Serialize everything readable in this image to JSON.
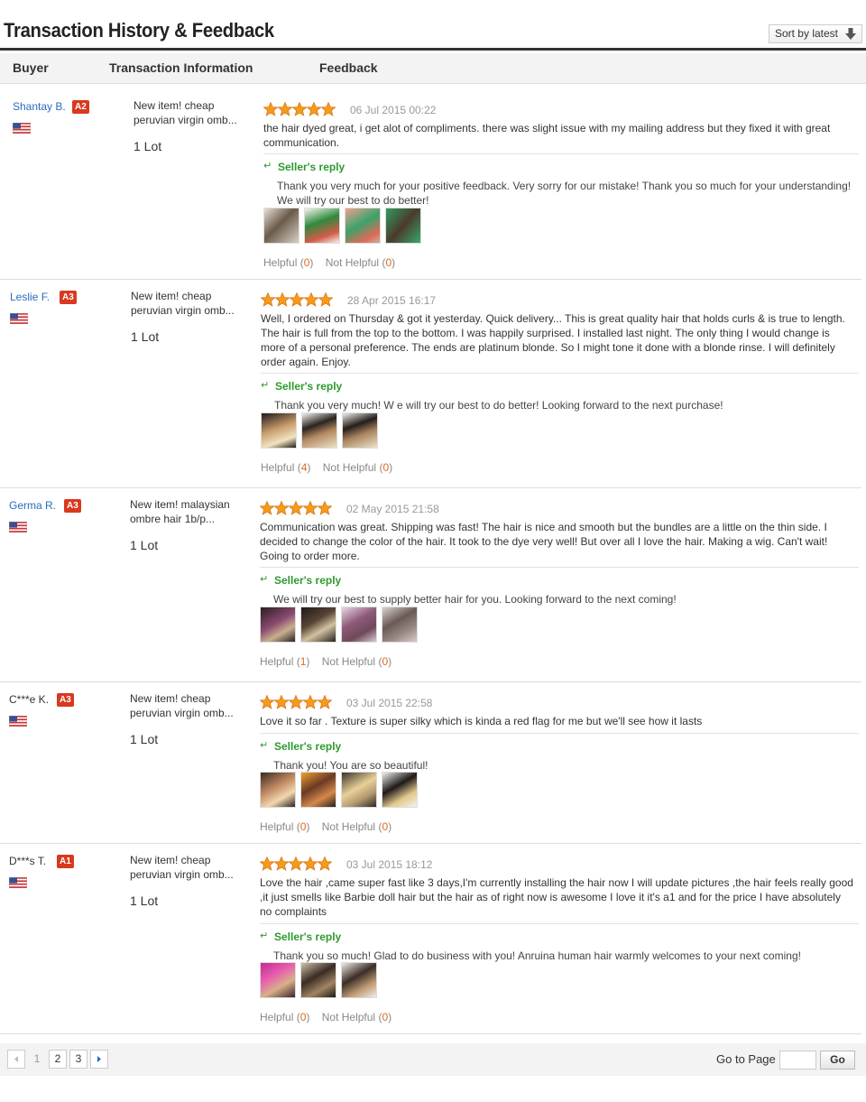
{
  "header": {
    "title": "Transaction History & Feedback",
    "sort_label": "Sort by latest"
  },
  "columns": {
    "buyer": "Buyer",
    "transaction": "Transaction Information",
    "feedback": "Feedback"
  },
  "reviews": [
    {
      "buyer": "Shantay B.",
      "level": "A2",
      "product_line1": "New item! cheap",
      "product_line2": "peruvian virgin omb...",
      "qty": "1 Lot",
      "stars": 5,
      "date": "06 Jul 2015 00:22",
      "comment": "the hair dyed great, i get alot of compliments. there was slight issue with my mailing address but they fixed it with great communication.",
      "reply_label": "Seller's reply",
      "reply": "Thank you very much for your positive feedback. Very sorry for our mistake! Thank you so much for your understanding! We will try our best to do better!",
      "photos": 4,
      "helpful_label": "Helpful",
      "helpful_count": "0",
      "not_helpful_label": "Not Helpful",
      "not_helpful_count": "0"
    },
    {
      "buyer": "Leslie F.",
      "level": "A3",
      "product_line1": "New item! cheap",
      "product_line2": "peruvian virgin omb...",
      "qty": "1 Lot",
      "stars": 5,
      "date": "28 Apr 2015 16:17",
      "comment": "Well, I ordered on Thursday & got it yesterday. Quick delivery... This is great quality hair that holds curls & is true to length. The hair is full from the top to the bottom. I was happily surprised. I installed last night. The only thing I would change is more of a personal preference. The ends are platinum blonde. So I might tone it done with a blonde rinse. I will definitely order again. Enjoy.",
      "reply_label": "Seller's reply",
      "reply": "Thank you very much! W e will try our best to do better! Looking forward to the next purchase!",
      "photos": 3,
      "helpful_label": "Helpful",
      "helpful_count": "4",
      "not_helpful_label": "Not Helpful",
      "not_helpful_count": "0"
    },
    {
      "buyer": "Germa R.",
      "level": "A3",
      "product_line1": "New item! malaysian",
      "product_line2": "ombre hair 1b/p...",
      "qty": "1 Lot",
      "stars": 5,
      "date": "02 May 2015 21:58",
      "comment": "Communication was great. Shipping was fast! The hair is nice and smooth but the bundles are a little on the thin side. I decided to change the color of the hair. It took to the dye very well! But over all I love the hair. Making a wig. Can't wait! Going to order more.",
      "reply_label": "Seller's reply",
      "reply": "We will try our best to supply better hair for you. Looking forward to the next coming!",
      "photos": 4,
      "helpful_label": "Helpful",
      "helpful_count": "1",
      "not_helpful_label": "Not Helpful",
      "not_helpful_count": "0"
    },
    {
      "buyer": "C***e K.",
      "level": "A3",
      "product_line1": "New item! cheap",
      "product_line2": "peruvian virgin omb...",
      "qty": "1 Lot",
      "stars": 5,
      "date": "03 Jul 2015 22:58",
      "comment": "Love it so far . Texture is super silky which is kinda a red flag for me but we'll see how it lasts",
      "reply_label": "Seller's reply",
      "reply": "Thank you! You are so beautiful!",
      "photos": 4,
      "helpful_label": "Helpful",
      "helpful_count": "0",
      "not_helpful_label": "Not Helpful",
      "not_helpful_count": "0"
    },
    {
      "buyer": "D***s T.",
      "level": "A1",
      "product_line1": "New item! cheap",
      "product_line2": "peruvian virgin omb...",
      "qty": "1 Lot",
      "stars": 5,
      "date": "03 Jul 2015 18:12",
      "comment": "Love the hair ,came super fast like 3 days,I'm currently installing the hair now I will update pictures ,the hair feels really good ,it just smells like Barbie doll hair but the hair as of right now is awesome I love it it's a1 and for the price I have absolutely no complaints",
      "reply_label": "Seller's reply",
      "reply": "Thank you so much! Glad to do business with you! Anruina human hair warmly welcomes to your next coming!",
      "photos": 3,
      "helpful_label": "Helpful",
      "helpful_count": "0",
      "not_helpful_label": "Not Helpful",
      "not_helpful_count": "0"
    }
  ],
  "pagination": {
    "pages": [
      "1",
      "2",
      "3"
    ],
    "current": "1",
    "goto_label": "Go to Page",
    "goto_value": "",
    "go_button": "Go"
  },
  "colors": {
    "accent_link": "#2a6ebb",
    "badge": "#d9391e",
    "reply_green": "#2e9a2e",
    "count_orange": "#e0691c",
    "star": "#f59b1b"
  },
  "icons": {
    "sort": "arrow-down-icon",
    "star": "star-icon",
    "flag": "us-flag-icon",
    "reply": "reply-arrow-icon",
    "prev": "triangle-left-icon",
    "next": "triangle-right-icon"
  }
}
